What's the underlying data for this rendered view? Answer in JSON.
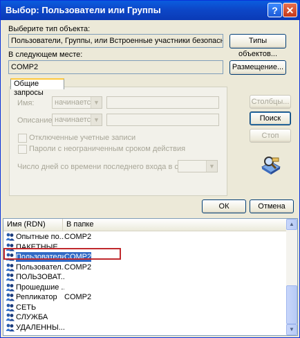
{
  "window": {
    "title": "Выбор: Пользователи или Группы",
    "help_label": "?",
    "close_label": "✕"
  },
  "object_type": {
    "label": "Выберите тип объекта:",
    "value": "Пользователи, Группы, или Встроенные участники безопасности",
    "button": "Типы объектов..."
  },
  "location": {
    "label": "В следующем месте:",
    "value": "COMP2",
    "button": "Размещение..."
  },
  "queries": {
    "tab": "Общие запросы",
    "name_label": "Имя:",
    "name_combo": "начинается",
    "desc_label": "Описание:",
    "desc_combo": "начинается",
    "disabled_accounts": "Отключенные учетные записи",
    "no_expire": "Пароли с неограниченным сроком действия",
    "days_label": "Число дней со времени последнего входа в систему:"
  },
  "side_buttons": {
    "columns": "Столбцы...",
    "search": "Поиск",
    "stop": "Стоп"
  },
  "footer": {
    "ok": "ОК",
    "cancel": "Отмена"
  },
  "results": {
    "headers": [
      "Имя (RDN)",
      "В папке"
    ],
    "rows": [
      {
        "name": "Опытные по...",
        "folder": "COMP2"
      },
      {
        "name": "ПАКЕТНЫЕ ...",
        "folder": ""
      },
      {
        "name": "Пользователи",
        "folder": "COMP2",
        "selected": true
      },
      {
        "name": "Пользовател...",
        "folder": "COMP2"
      },
      {
        "name": "ПОЛЬЗОВАТ...",
        "folder": ""
      },
      {
        "name": "Прошедшие ...",
        "folder": ""
      },
      {
        "name": "Репликатор",
        "folder": "COMP2"
      },
      {
        "name": "СЕТЬ",
        "folder": ""
      },
      {
        "name": "СЛУЖБА",
        "folder": ""
      },
      {
        "name": "УДАЛЕННЫ...",
        "folder": ""
      }
    ]
  },
  "colors": {
    "title_bar": "#0a5ddf",
    "selection": "#316ac5",
    "highlight_border": "#c0282c"
  }
}
